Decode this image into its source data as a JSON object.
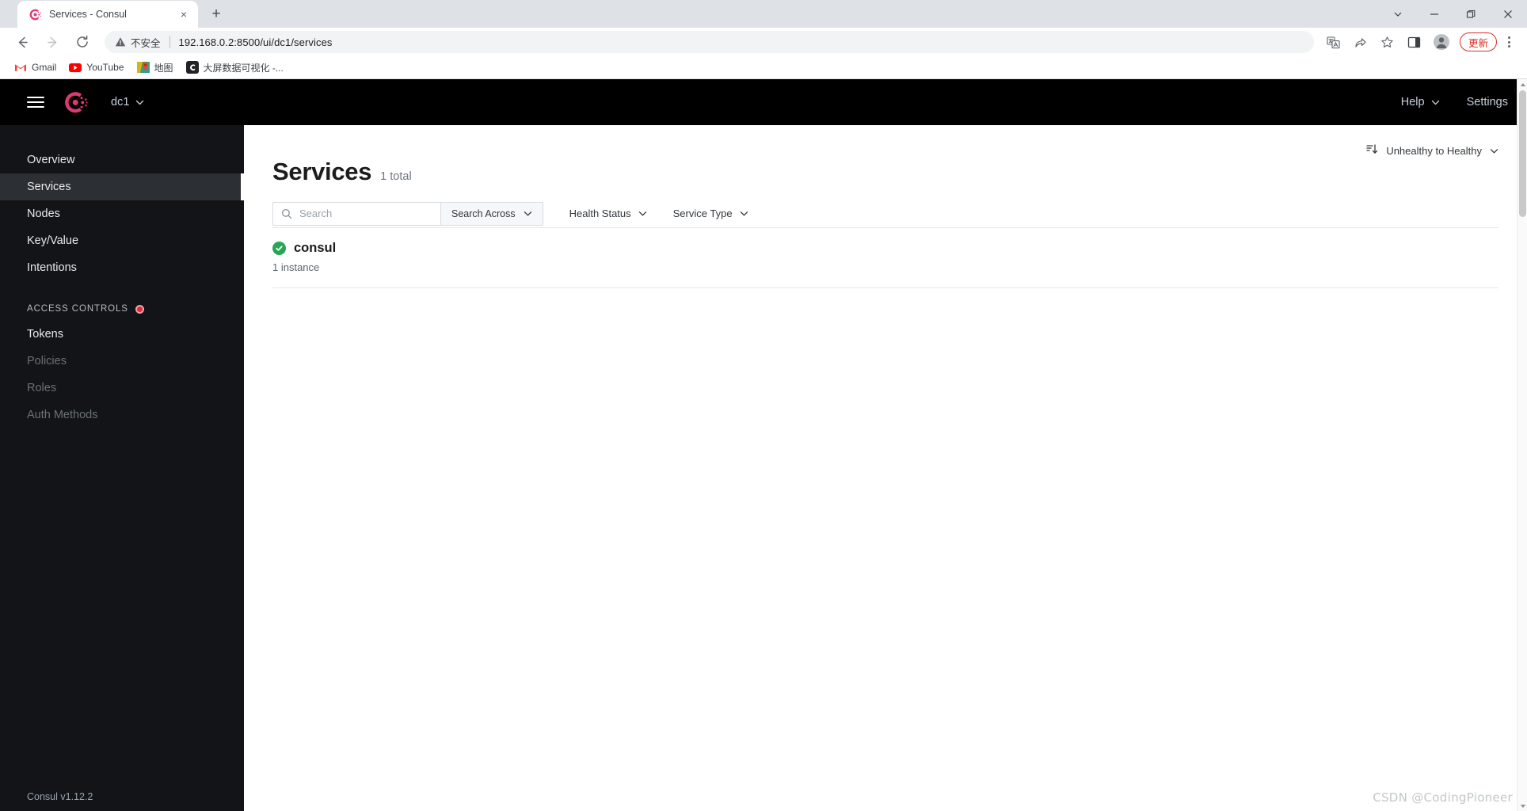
{
  "browser": {
    "tab": {
      "title": "Services - Consul",
      "favicon": "consul-icon",
      "close": "×"
    },
    "new_tab_label": "+",
    "window_controls": [
      {
        "name": "tab-search-button",
        "glyph": "chevron-down-icon"
      },
      {
        "name": "minimize-button",
        "glyph": "minimize-icon"
      },
      {
        "name": "maximize-button",
        "glyph": "maximize-icon"
      },
      {
        "name": "close-window-button",
        "glyph": "close-icon"
      }
    ],
    "nav": {
      "back": "back-icon",
      "forward": "forward-icon",
      "reload": "reload-icon"
    },
    "omnibox": {
      "security_text": "不安全",
      "url": "192.168.0.2:8500/ui/dc1/services"
    },
    "toolbar_icons": [
      "translate-icon",
      "share-icon",
      "bookmark-star-icon",
      "side-panel-icon",
      "profile-avatar-icon"
    ],
    "update_button": "更新",
    "bookmarks": [
      {
        "label": "Gmail",
        "icon": "gmail-icon"
      },
      {
        "label": "YouTube",
        "icon": "youtube-icon"
      },
      {
        "label": "地图",
        "icon": "google-maps-icon"
      },
      {
        "label": "大屏数据可视化 -...",
        "icon": "csdn-icon"
      }
    ]
  },
  "app_header": {
    "menu": "hamburger-icon",
    "logo": "consul-logo",
    "datacenter": "dc1",
    "help": "Help",
    "settings": "Settings"
  },
  "sidebar": {
    "items": [
      {
        "label": "Overview",
        "active": false,
        "muted": false
      },
      {
        "label": "Services",
        "active": true,
        "muted": false
      },
      {
        "label": "Nodes",
        "active": false,
        "muted": false
      },
      {
        "label": "Key/Value",
        "active": false,
        "muted": false
      },
      {
        "label": "Intentions",
        "active": false,
        "muted": false
      }
    ],
    "section_label": "ACCESS CONTROLS",
    "acl_items": [
      {
        "label": "Tokens",
        "muted": false
      },
      {
        "label": "Policies",
        "muted": true
      },
      {
        "label": "Roles",
        "muted": true
      },
      {
        "label": "Auth Methods",
        "muted": true
      }
    ],
    "footer_version": "Consul v1.12.2"
  },
  "main": {
    "title": "Services",
    "count": "1 total",
    "search": {
      "placeholder": "Search",
      "value": ""
    },
    "search_across": "Search Across",
    "filters": [
      "Health Status",
      "Service Type"
    ],
    "sort": {
      "label": "Unhealthy to Healthy",
      "icon": "sort-descending-icon"
    },
    "services": [
      {
        "name": "consul",
        "instances": "1 instance",
        "status": "healthy",
        "status_color": "#26a653"
      }
    ]
  },
  "watermark": "CSDN @CodingPioneer",
  "colors": {
    "consul_pink": "#e03875",
    "accent_red": "#dc2c3e",
    "healthy_green": "#26a653",
    "sidebar_bg": "#121417",
    "header_bg": "#000000"
  }
}
